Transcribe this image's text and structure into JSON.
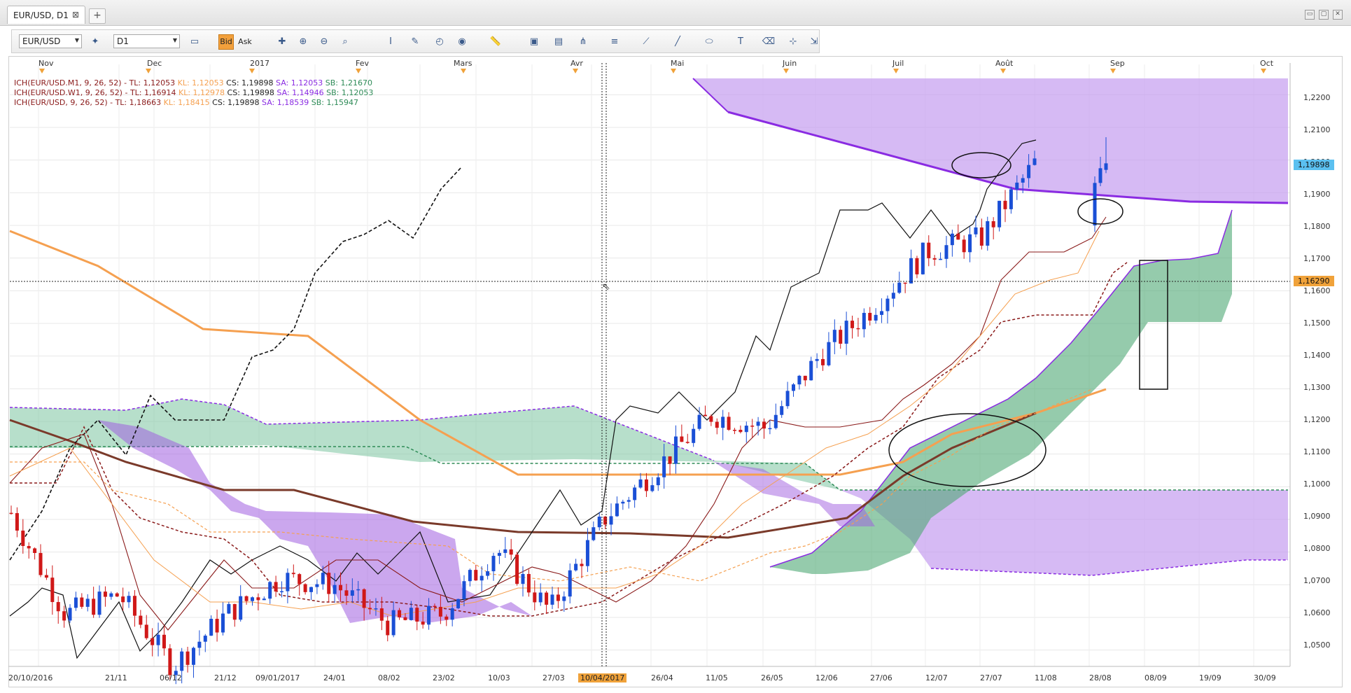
{
  "window": {
    "tab_title": "EUR/USD, D1",
    "tab_close": "⊠",
    "tab_add": "+",
    "win_buttons": [
      "▭",
      "▢",
      "✕"
    ]
  },
  "toolbar": {
    "symbol": "EUR/USD",
    "timeframe": "D1",
    "bid_label": "Bid",
    "ask_label": "Ask",
    "icons": [
      "chart-type-icon",
      "indicator-icon",
      "crosshair-icon",
      "zoom-in-icon",
      "zoom-out-icon",
      "magnifier-icon",
      "bar-icon",
      "draw-icon",
      "clock-icon",
      "globe-icon",
      "ruler-icon",
      "image-icon",
      "screenshot-icon",
      "fork-icon",
      "lines-icon",
      "fan-icon",
      "trendline-icon",
      "ellipse-icon",
      "text-icon",
      "eraser-icon",
      "tree-icon",
      "pin-icon"
    ]
  },
  "legend": [
    {
      "name": "ICH(EUR/USD.M1, 9, 26, 52) - ",
      "tl": "TL: 1,12053",
      "kl": "KL: 1,12053",
      "cs": "CS: 1,19898",
      "sa": "SA: 1,12053",
      "sb": "SB: 1,21670",
      "name_color": "#8a1a1a"
    },
    {
      "name": "ICH(EUR/USD.W1, 9, 26, 52) - ",
      "tl": "TL: 1,16914",
      "kl": "KL: 1,12978",
      "cs": "CS: 1,19898",
      "sa": "SA: 1,14946",
      "sb": "SB: 1,12053",
      "name_color": "#8a1a1a"
    },
    {
      "name": "ICH(EUR/USD, 9, 26, 52) - ",
      "tl": "TL: 1,18663",
      "kl": "KL: 1,18415",
      "cs": "CS: 1,19898",
      "sa": "SA: 1,18539",
      "sb": "SB: 1,15947",
      "name_color": "#8a1a1a"
    }
  ],
  "months": [
    "Nov",
    "Dec",
    "2017",
    "Fev",
    "Mars",
    "Avr",
    "Mai",
    "Juin",
    "Juil",
    "Août",
    "Sep",
    "Oct"
  ],
  "dates": [
    "20/10/2016",
    "21/11",
    "06/12",
    "21/12",
    "09/01/2017",
    "24/01",
    "08/02",
    "23/02",
    "10/03",
    "27/03",
    "10/04/2017",
    "26/04",
    "11/05",
    "26/05",
    "12/06",
    "27/06",
    "12/07",
    "27/07",
    "11/08",
    "28/08",
    "08/09",
    "19/09",
    "30/09"
  ],
  "yticks": [
    "1,2200",
    "1,2100",
    "1,2000",
    "1,1900",
    "1,1800",
    "1,1700",
    "1,1600",
    "1,1500",
    "1,1400",
    "1,1300",
    "1,1200",
    "1,1100",
    "1,1000",
    "1,0900",
    "1,0800",
    "1,0700",
    "1,0600",
    "1,0500"
  ],
  "price_badge": "1,19898",
  "cursor_badge": "1,16290",
  "colors": {
    "up": "#1a4fd6",
    "down": "#d01818",
    "purple": "#8a2be2",
    "green": "#2e8b57",
    "orange": "#f5a050"
  },
  "chart_data": {
    "type": "line",
    "title": "EUR/USD, D1",
    "ylim": [
      1.045,
      1.225
    ],
    "grid": true,
    "close_path": {
      "x": [
        "20/10/2016",
        "21/11",
        "06/12",
        "21/12",
        "09/01/2017",
        "24/01",
        "08/02",
        "23/02",
        "10/03",
        "27/03",
        "10/04/2017",
        "26/04",
        "11/05",
        "26/05",
        "12/06",
        "27/06",
        "12/07",
        "27/07",
        "11/08",
        "28/08"
      ],
      "values": [
        1.092,
        1.061,
        1.067,
        1.045,
        1.061,
        1.072,
        1.07,
        1.058,
        1.061,
        1.081,
        1.062,
        1.09,
        1.106,
        1.122,
        1.118,
        1.14,
        1.155,
        1.172,
        1.176,
        1.199
      ]
    }
  }
}
